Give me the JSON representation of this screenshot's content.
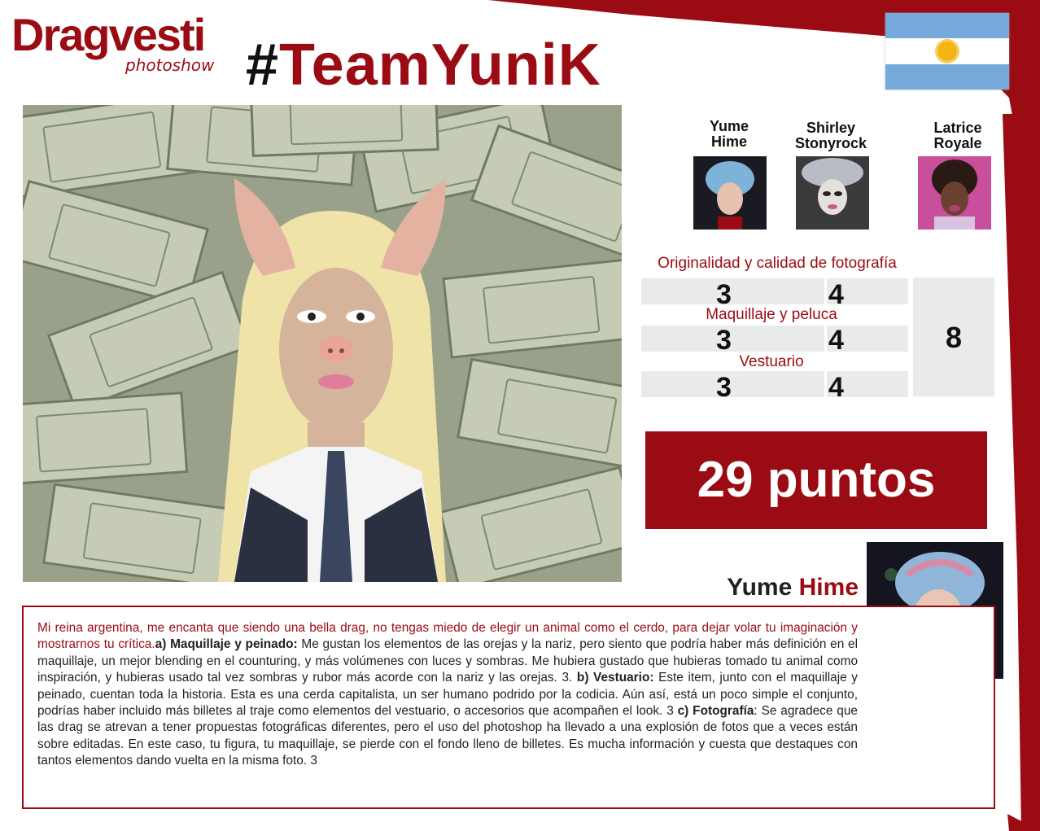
{
  "logo": {
    "main": "Dragvesti",
    "sub": "photoshow"
  },
  "hashtag": {
    "hash": "#",
    "team": "TeamYuniK"
  },
  "colors": {
    "accent": "#9b0b13",
    "flag_blue": "#75aadb",
    "flag_sun": "#f3b416",
    "panel_gray": "#e9eaea"
  },
  "judges": [
    {
      "name": "Yume\nHime",
      "line1": "Yume",
      "line2": "Hime"
    },
    {
      "name": "Shirley\nStonyrock",
      "line1": "Shirley",
      "line2": "Stonyrock"
    },
    {
      "name": "Latrice\nRoyale",
      "line1": "Latrice",
      "line2": "Royale"
    }
  ],
  "scores": {
    "criteria": [
      {
        "label": "Originalidad y calidad de fotografía",
        "a": "3",
        "b": "4"
      },
      {
        "label": "Maquillaje y peluca",
        "a": "3",
        "b": "4"
      },
      {
        "label": "Vestuario",
        "a": "3",
        "b": "4"
      }
    ],
    "third_judge": "8"
  },
  "total": "29 puntos",
  "featured": {
    "first": "Yume",
    "last": "Hime"
  },
  "critique": {
    "intro": "Mi reina argentina, me encanta que siendo una bella drag, no tengas miedo de elegir un animal como el cerdo, para dejar volar tu imaginación y mostrarnos tu crítica.",
    "a_label": "a) Maquillaje y peinado:",
    "a_text": " Me gustan los elementos de las orejas y la nariz, pero siento que podría haber más definición en el maquillaje, un mejor blending en el counturing, y más volúmenes con luces y sombras. Me hubiera gustado que hubieras tomado tu animal como inspiración, y hubieras usado tal vez sombras y rubor más acorde con la nariz y las orejas. 3. ",
    "b_label": "b) Vestuario:",
    "b_text": " Este item, junto con el maquillaje y peinado, cuentan toda la historia. Esta es una cerda capitalista, un ser humano podrido por la codicia. Aún así, está un poco simple el conjunto, podrías haber incluido más billetes al traje como elementos del vestuario, o accesorios que acompañen el look. 3 ",
    "c_label": "c) Fotografía",
    "c_text": ": Se agradece que las drag se atrevan a tener propuestas fotográficas diferentes, pero el uso del photoshop ha llevado a una explosión de fotos que a veces están sobre editadas. En este caso, tu figura, tu maquillaje, se pierde con el fondo lleno de billetes. Es mucha información y cuesta que destaques con tantos elementos dando vuelta en la misma foto. 3"
  }
}
